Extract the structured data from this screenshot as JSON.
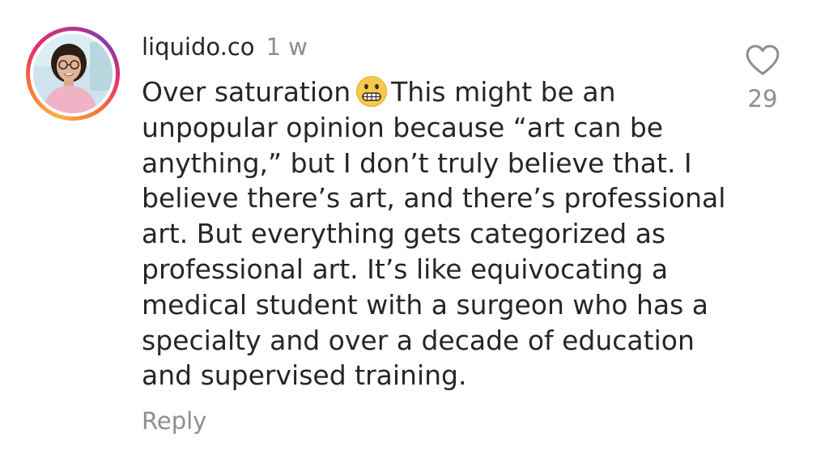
{
  "comment": {
    "username": "liquido.co",
    "time_ago": "1 w",
    "avatar_icon": "profile-photo-woman-with-glasses",
    "emoji_icon": "grimacing-face-emoji",
    "text_lines": [
      {
        "before": "Over saturation",
        "after": "This might be an"
      },
      "unpopular opinion because “art can be",
      "anything,” but I don’t truly believe that. I",
      "believe there’s art, and there’s professional",
      "art. But everything gets categorized as",
      "professional art. It’s like equivocating a",
      "medical student with a surgeon who has a",
      "specialty and over a decade of education",
      "and supervised training."
    ],
    "reply_label": "Reply",
    "like_icon": "heart-outline-icon",
    "like_count": "29"
  },
  "colors": {
    "text_primary": "#262626",
    "text_secondary": "#8e8e8e",
    "story_ring": [
      "#fcaf45",
      "#f77737",
      "#e1306c",
      "#c13584",
      "#833ab4"
    ],
    "background": "#ffffff"
  }
}
